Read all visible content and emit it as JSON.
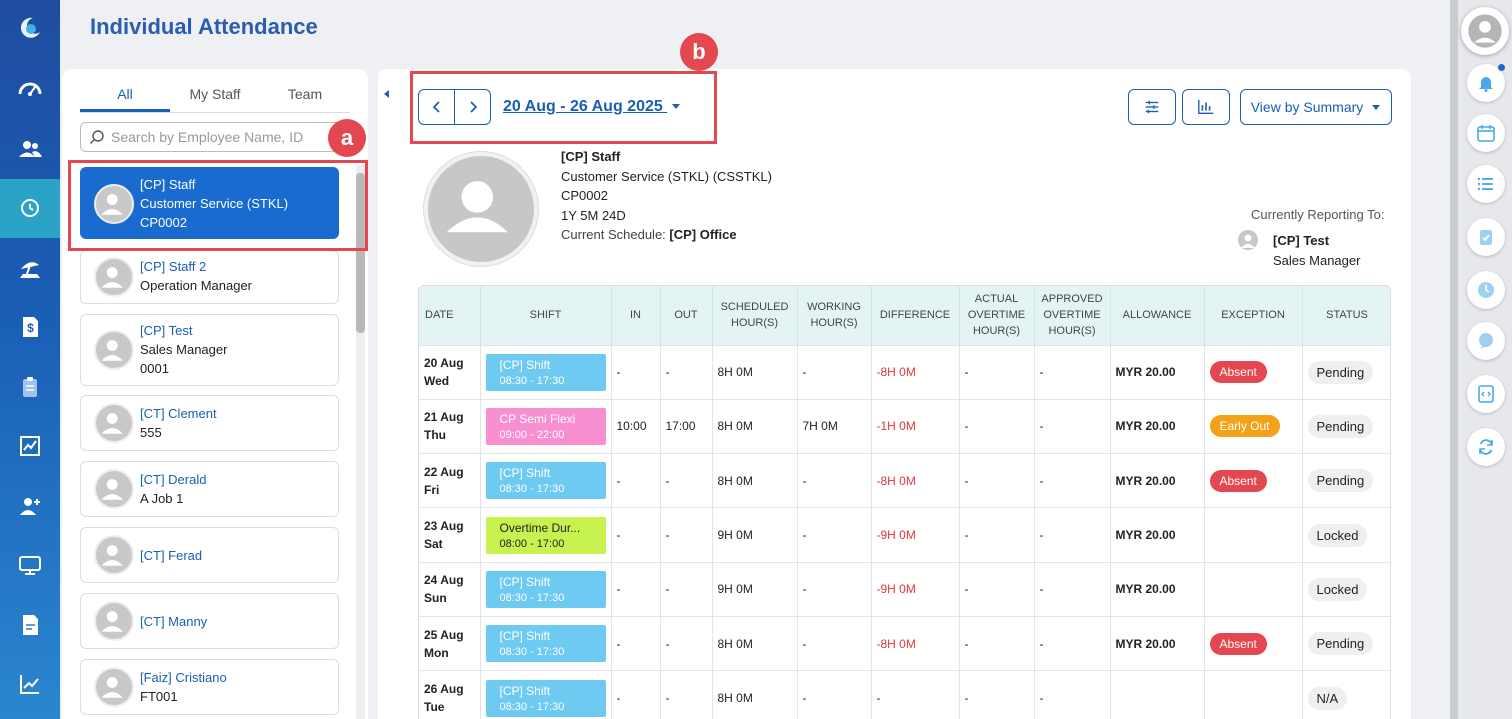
{
  "page_title": "Individual Attendance",
  "nav_icons": [
    "dashboard-icon",
    "people-icon",
    "attendance-clock-icon",
    "leave-icon",
    "payroll-dollar-icon",
    "clipboard-icon",
    "report-chart-icon",
    "add-user-icon",
    "monitor-icon",
    "document-icon",
    "analytics-icon"
  ],
  "staff_panel": {
    "tabs": [
      "All",
      "My Staff",
      "Team"
    ],
    "active_tab": "All",
    "search_placeholder": "Search by Employee Name, ID",
    "staff": [
      {
        "name": "[CP] Staff",
        "line2": "Customer Service (STKL)",
        "line3": "CP0002",
        "selected": true
      },
      {
        "name": "[CP] Staff 2",
        "line2": "Operation Manager",
        "line3": ""
      },
      {
        "name": "[CP] Test",
        "line2": "Sales Manager",
        "line3": "0001"
      },
      {
        "name": "[CT] Clement",
        "line2": "555",
        "line3": ""
      },
      {
        "name": "[CT] Derald",
        "line2": "A Job 1",
        "line3": ""
      },
      {
        "name": "[CT] Ferad",
        "line2": "",
        "line3": ""
      },
      {
        "name": "[CT] Manny",
        "line2": "",
        "line3": ""
      },
      {
        "name": "[Faiz] Cristiano",
        "line2": "FT001",
        "line3": ""
      }
    ]
  },
  "annotations": {
    "a": "a",
    "b": "b"
  },
  "toolbar": {
    "date_range": "20 Aug - 26 Aug 2025",
    "view_select": "View by Summary"
  },
  "profile": {
    "name": "[CP] Staff",
    "department": "Customer Service (STKL) (CSSTKL)",
    "employee_id": "CP0002",
    "tenure": "1Y 5M 24D",
    "schedule_label": "Current Schedule:",
    "schedule_value": "[CP] Office",
    "reporting_label": "Currently Reporting To:",
    "reporting_name": "[CP] Test",
    "reporting_title": "Sales Manager"
  },
  "table": {
    "headers": [
      "DATE",
      "SHIFT",
      "IN",
      "OUT",
      "SCHEDULED HOUR(S)",
      "WORKING HOUR(S)",
      "DIFFERENCE",
      "ACTUAL OVERTIME HOUR(S)",
      "APPROVED OVERTIME HOUR(S)",
      "ALLOWANCE",
      "EXCEPTION",
      "STATUS"
    ],
    "rows": [
      {
        "date": "20 Aug",
        "day": "Wed",
        "shift": "[CP] Shift",
        "shift_time": "08:30 - 17:30",
        "shift_color": "blue",
        "in": "-",
        "out": "-",
        "scheduled": "8H 0M",
        "working": "-",
        "difference": "-8H 0M",
        "actual_ot": "-",
        "approved_ot": "-",
        "allowance": "MYR 20.00",
        "exception": "Absent",
        "exception_color": "red",
        "status": "Pending"
      },
      {
        "date": "21 Aug",
        "day": "Thu",
        "shift": "CP Semi Flexi",
        "shift_time": "09:00 - 22:00",
        "shift_color": "pink",
        "in": "10:00",
        "out": "17:00",
        "scheduled": "8H 0M",
        "working": "7H 0M",
        "difference": "-1H 0M",
        "actual_ot": "-",
        "approved_ot": "-",
        "allowance": "MYR 20.00",
        "exception": "Early Out",
        "exception_color": "orange",
        "status": "Pending"
      },
      {
        "date": "22 Aug",
        "day": "Fri",
        "shift": "[CP] Shift",
        "shift_time": "08:30 - 17:30",
        "shift_color": "blue",
        "in": "-",
        "out": "-",
        "scheduled": "8H 0M",
        "working": "-",
        "difference": "-8H 0M",
        "actual_ot": "-",
        "approved_ot": "-",
        "allowance": "MYR 20.00",
        "exception": "Absent",
        "exception_color": "red",
        "status": "Pending"
      },
      {
        "date": "23 Aug",
        "day": "Sat",
        "shift": "Overtime Dur...",
        "shift_time": "08:00 - 17:00",
        "shift_color": "green",
        "in": "-",
        "out": "-",
        "scheduled": "9H 0M",
        "working": "-",
        "difference": "-9H 0M",
        "actual_ot": "-",
        "approved_ot": "-",
        "allowance": "MYR 20.00",
        "exception": "",
        "exception_color": "",
        "status": "Locked"
      },
      {
        "date": "24 Aug",
        "day": "Sun",
        "shift": "[CP] Shift",
        "shift_time": "08:30 - 17:30",
        "shift_color": "blue",
        "in": "-",
        "out": "-",
        "scheduled": "9H 0M",
        "working": "-",
        "difference": "-9H 0M",
        "actual_ot": "-",
        "approved_ot": "-",
        "allowance": "MYR 20.00",
        "exception": "",
        "exception_color": "",
        "status": "Locked"
      },
      {
        "date": "25 Aug",
        "day": "Mon",
        "shift": "[CP] Shift",
        "shift_time": "08:30 - 17:30",
        "shift_color": "blue",
        "in": "-",
        "out": "-",
        "scheduled": "8H 0M",
        "working": "-",
        "difference": "-8H 0M",
        "actual_ot": "-",
        "approved_ot": "-",
        "allowance": "MYR 20.00",
        "exception": "Absent",
        "exception_color": "red",
        "status": "Pending"
      },
      {
        "date": "26 Aug",
        "day": "Tue",
        "shift": "[CP] Shift",
        "shift_time": "08:30 - 17:30",
        "shift_color": "blue",
        "in": "-",
        "out": "-",
        "scheduled": "8H 0M",
        "working": "-",
        "difference": "-",
        "actual_ot": "-",
        "approved_ot": "-",
        "allowance": "",
        "exception": "",
        "exception_color": "",
        "status": "N/A"
      }
    ]
  },
  "right_rail_icons": [
    "bell-icon",
    "calendar-icon",
    "list-icon",
    "clipboard-check-icon",
    "clock-icon",
    "chat-icon",
    "code-icon",
    "refresh-icon"
  ]
}
